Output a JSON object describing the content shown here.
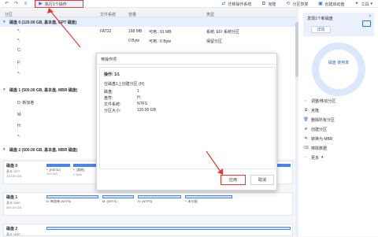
{
  "toolbar": {
    "execute_label": "执行1个操作",
    "items": [
      {
        "label": "迁移操作系统"
      },
      {
        "label": "克隆"
      },
      {
        "label": "分区恢复"
      },
      {
        "label": "创建启动盘"
      },
      {
        "label": "工具"
      }
    ]
  },
  "table_header": {
    "partition": "分区",
    "fs": "文件系统",
    "capacity": "容量",
    "type": "类型"
  },
  "rows": [
    {
      "name": "磁盘 0 (120.00 GB, 基本盘, GPT 磁盘)",
      "disk": true
    },
    {
      "name": "*:",
      "fs": "FAT32",
      "size": "168 MB",
      "free": "可用.. 91 MB",
      "type": "系统, EFI 系统分区"
    },
    {
      "name": "*:",
      "fs": "",
      "size": "0 Byte",
      "free": "可用.. 0 Byte",
      "type": "保留分区"
    },
    {
      "name": "C:",
      "fs": "",
      "size": "",
      "free": "",
      "type": ""
    },
    {
      "name": "F:",
      "fs": "",
      "size": "",
      "free": "",
      "type": ""
    },
    {
      "name": "*:",
      "fs": "",
      "size": "",
      "free": "",
      "type": ""
    },
    {
      "name": "磁盘 1 (500.00 GB, 基本盘, MBR 磁盘)",
      "disk": true
    },
    {
      "name": "D: 新加卷",
      "fs": "",
      "size": "",
      "free": "",
      "type": ""
    },
    {
      "name": "M:",
      "fs": "",
      "size": "",
      "free": "",
      "type": ""
    },
    {
      "name": "H:",
      "fs": "",
      "size": "",
      "free": "",
      "type": ""
    },
    {
      "name": "*:",
      "fs": "",
      "size": "",
      "free": "",
      "type": ""
    },
    {
      "name": "磁盘 2 (500.00 GB, 基本盘, MBR 磁盘)",
      "disk": true
    }
  ],
  "disks": [
    {
      "name": "磁盘 0",
      "type": "基本 GPT",
      "size": "120.00 GB",
      "segments": [
        {
          "label": "*: (FAT32)",
          "size": "168 MB",
          "filled": true
        },
        {
          "label": "*: (其他)",
          "size": "0 Byte",
          "filled": true
        },
        {
          "label": "",
          "size": "",
          "filled": true
        },
        {
          "label": "",
          "size": "",
          "filled": true
        }
      ]
    },
    {
      "name": "磁盘 1",
      "type": "基本 MBR",
      "size": "500.00 GB",
      "segments": [
        {
          "label": "D: 新加卷 (NTFS)",
          "size": "",
          "filled": false
        },
        {
          "label": "M: (NTFS)",
          "size": "",
          "filled": false
        },
        {
          "label": "H: (NTFS)",
          "size": "",
          "filled": false
        },
        {
          "label": "*: 未分配",
          "size": "",
          "filled": false
        }
      ]
    },
    {
      "name": "磁盘 2",
      "type": "基本 MBR",
      "size": "",
      "segments": []
    }
  ],
  "right_panel": {
    "found_text": "发现1个新磁盘",
    "detail_button": "详情",
    "gauge_label": "磁盘 使用率",
    "operations": [
      {
        "label": "调整/移动分区",
        "icon": "resize-icon"
      },
      {
        "label": "克隆",
        "icon": "clone-icon"
      },
      {
        "label": "删除所有分区",
        "icon": "delete-icon"
      },
      {
        "label": "创建分区",
        "icon": "add-icon"
      },
      {
        "label": "转换为 MBR",
        "icon": "convert-icon"
      },
      {
        "label": "擦除数据",
        "icon": "wipe-icon"
      },
      {
        "label": "更多",
        "icon": "more-icon"
      }
    ]
  },
  "dialog": {
    "title": "待操作项",
    "op_header": "操作: 1/1",
    "op_desc": "在磁盘1上创建分区 (H)",
    "fields": [
      {
        "key": "磁盘:",
        "value": "1"
      },
      {
        "key": "盘符:",
        "value": "H:"
      },
      {
        "key": "文件系统:",
        "value": "NTFS"
      },
      {
        "key": "分区大小:",
        "value": "120.00 GB"
      }
    ],
    "apply_label": "应用",
    "cancel_label": "取消"
  },
  "colors": {
    "accent": "#3c6fd6",
    "highlight": "#e53935",
    "partition": "#4a86e8"
  }
}
